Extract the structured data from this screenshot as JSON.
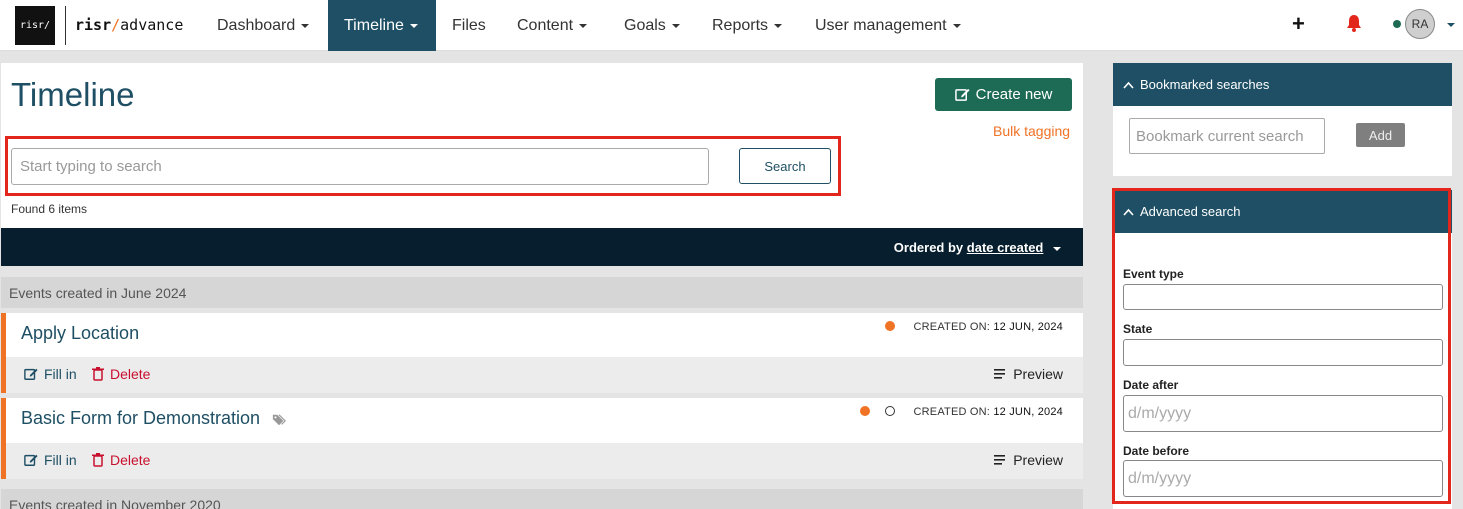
{
  "brand": {
    "logo_box": "risr/",
    "name_bold": "risr",
    "name_slash": "/",
    "name_rest": "advance"
  },
  "nav": {
    "items": [
      {
        "label": "Dashboard",
        "dropdown": true
      },
      {
        "label": "Timeline",
        "dropdown": true,
        "active": true
      },
      {
        "label": "Files",
        "dropdown": false
      },
      {
        "label": "Content",
        "dropdown": true
      },
      {
        "label": "Goals",
        "dropdown": true
      },
      {
        "label": "Reports",
        "dropdown": true
      },
      {
        "label": "User management",
        "dropdown": true
      }
    ],
    "plus": "+",
    "avatar_initials": "RA"
  },
  "page": {
    "title": "Timeline",
    "create_new_label": "Create new",
    "bulk_tagging_label": "Bulk tagging",
    "search_placeholder": "Start typing to search",
    "search_button": "Search",
    "found_text": "Found 6 items",
    "ordered_by_prefix": "Ordered by",
    "ordered_by_value": "date created"
  },
  "groups": [
    {
      "heading": "Events created in June 2024",
      "events": [
        {
          "title": "Apply Location",
          "created_label": "CREATED ON:",
          "created_date": "12 JUN, 2024",
          "tagged": false
        },
        {
          "title": "Basic Form for Demonstration",
          "created_label": "CREATED ON:",
          "created_date": "12 JUN, 2024",
          "tagged": true
        }
      ]
    },
    {
      "heading": "Events created in November 2020",
      "events": []
    }
  ],
  "event_actions": {
    "fill_in": "Fill in",
    "delete": "Delete",
    "preview": "Preview"
  },
  "sidebar": {
    "bookmarked": {
      "title": "Bookmarked searches",
      "placeholder": "Bookmark current search",
      "add_label": "Add"
    },
    "advanced": {
      "title": "Advanced search",
      "fields": [
        {
          "label": "Event type",
          "placeholder": ""
        },
        {
          "label": "State",
          "placeholder": ""
        },
        {
          "label": "Date after",
          "placeholder": "d/m/yyyy"
        },
        {
          "label": "Date before",
          "placeholder": "d/m/yyyy"
        }
      ]
    }
  },
  "colors": {
    "primary": "#1e4f64",
    "accent": "#f07224",
    "create": "#1e6b55",
    "danger": "#c8102e",
    "highlight": "#e3261c"
  }
}
